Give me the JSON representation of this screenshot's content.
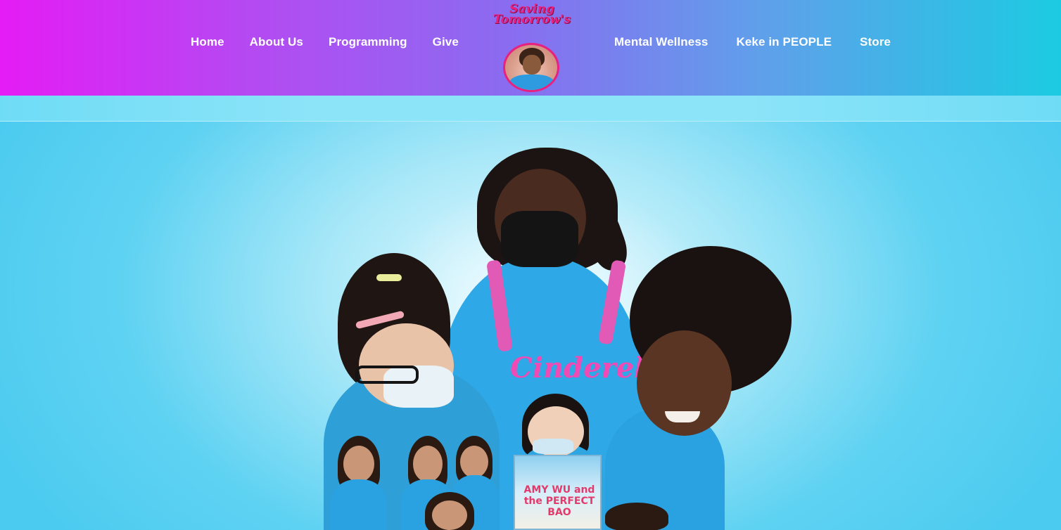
{
  "nav": {
    "left": [
      {
        "label": "Home"
      },
      {
        "label": "About Us"
      },
      {
        "label": "Programming"
      },
      {
        "label": "Give"
      }
    ],
    "right": [
      {
        "label": "Mental Wellness"
      },
      {
        "label": "Keke in PEOPLE"
      },
      {
        "label": "Store"
      }
    ]
  },
  "logo": {
    "line1": "Saving",
    "line2": "Tomorrow's",
    "image_icon": "founder-avatar"
  },
  "hero": {
    "shirt_text": "Cinderellas",
    "book_title": "AMY WU and the PERFECT BAO"
  },
  "colors": {
    "header_gradient_start": "#e41cf5",
    "header_gradient_end": "#1ccbe2",
    "background": "#4ccbf0",
    "brand_pink": "#e8207f"
  }
}
